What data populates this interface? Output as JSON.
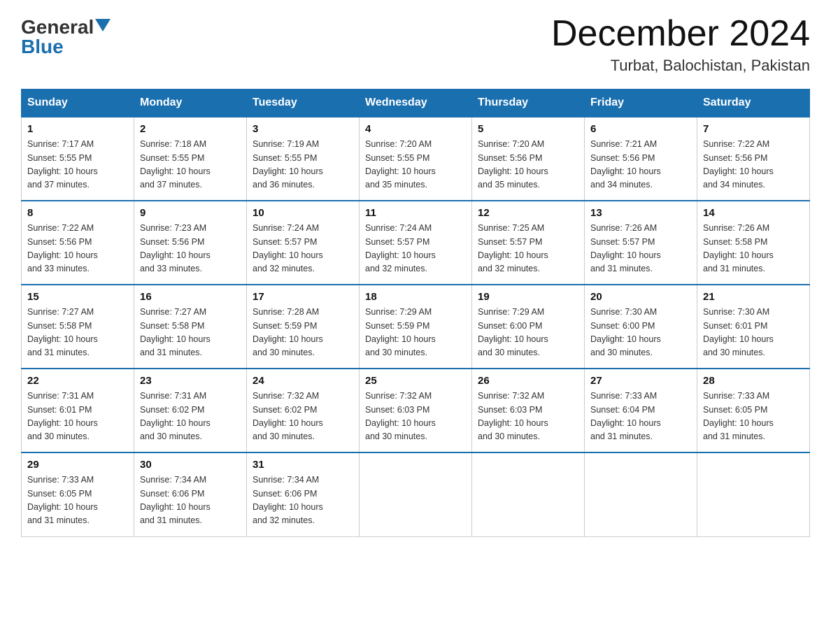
{
  "header": {
    "logo_general": "General",
    "logo_blue": "Blue",
    "month_year": "December 2024",
    "location": "Turbat, Balochistan, Pakistan"
  },
  "columns": [
    "Sunday",
    "Monday",
    "Tuesday",
    "Wednesday",
    "Thursday",
    "Friday",
    "Saturday"
  ],
  "weeks": [
    [
      {
        "day": "1",
        "sunrise": "7:17 AM",
        "sunset": "5:55 PM",
        "daylight": "10 hours and 37 minutes."
      },
      {
        "day": "2",
        "sunrise": "7:18 AM",
        "sunset": "5:55 PM",
        "daylight": "10 hours and 37 minutes."
      },
      {
        "day": "3",
        "sunrise": "7:19 AM",
        "sunset": "5:55 PM",
        "daylight": "10 hours and 36 minutes."
      },
      {
        "day": "4",
        "sunrise": "7:20 AM",
        "sunset": "5:55 PM",
        "daylight": "10 hours and 35 minutes."
      },
      {
        "day": "5",
        "sunrise": "7:20 AM",
        "sunset": "5:56 PM",
        "daylight": "10 hours and 35 minutes."
      },
      {
        "day": "6",
        "sunrise": "7:21 AM",
        "sunset": "5:56 PM",
        "daylight": "10 hours and 34 minutes."
      },
      {
        "day": "7",
        "sunrise": "7:22 AM",
        "sunset": "5:56 PM",
        "daylight": "10 hours and 34 minutes."
      }
    ],
    [
      {
        "day": "8",
        "sunrise": "7:22 AM",
        "sunset": "5:56 PM",
        "daylight": "10 hours and 33 minutes."
      },
      {
        "day": "9",
        "sunrise": "7:23 AM",
        "sunset": "5:56 PM",
        "daylight": "10 hours and 33 minutes."
      },
      {
        "day": "10",
        "sunrise": "7:24 AM",
        "sunset": "5:57 PM",
        "daylight": "10 hours and 32 minutes."
      },
      {
        "day": "11",
        "sunrise": "7:24 AM",
        "sunset": "5:57 PM",
        "daylight": "10 hours and 32 minutes."
      },
      {
        "day": "12",
        "sunrise": "7:25 AM",
        "sunset": "5:57 PM",
        "daylight": "10 hours and 32 minutes."
      },
      {
        "day": "13",
        "sunrise": "7:26 AM",
        "sunset": "5:57 PM",
        "daylight": "10 hours and 31 minutes."
      },
      {
        "day": "14",
        "sunrise": "7:26 AM",
        "sunset": "5:58 PM",
        "daylight": "10 hours and 31 minutes."
      }
    ],
    [
      {
        "day": "15",
        "sunrise": "7:27 AM",
        "sunset": "5:58 PM",
        "daylight": "10 hours and 31 minutes."
      },
      {
        "day": "16",
        "sunrise": "7:27 AM",
        "sunset": "5:58 PM",
        "daylight": "10 hours and 31 minutes."
      },
      {
        "day": "17",
        "sunrise": "7:28 AM",
        "sunset": "5:59 PM",
        "daylight": "10 hours and 30 minutes."
      },
      {
        "day": "18",
        "sunrise": "7:29 AM",
        "sunset": "5:59 PM",
        "daylight": "10 hours and 30 minutes."
      },
      {
        "day": "19",
        "sunrise": "7:29 AM",
        "sunset": "6:00 PM",
        "daylight": "10 hours and 30 minutes."
      },
      {
        "day": "20",
        "sunrise": "7:30 AM",
        "sunset": "6:00 PM",
        "daylight": "10 hours and 30 minutes."
      },
      {
        "day": "21",
        "sunrise": "7:30 AM",
        "sunset": "6:01 PM",
        "daylight": "10 hours and 30 minutes."
      }
    ],
    [
      {
        "day": "22",
        "sunrise": "7:31 AM",
        "sunset": "6:01 PM",
        "daylight": "10 hours and 30 minutes."
      },
      {
        "day": "23",
        "sunrise": "7:31 AM",
        "sunset": "6:02 PM",
        "daylight": "10 hours and 30 minutes."
      },
      {
        "day": "24",
        "sunrise": "7:32 AM",
        "sunset": "6:02 PM",
        "daylight": "10 hours and 30 minutes."
      },
      {
        "day": "25",
        "sunrise": "7:32 AM",
        "sunset": "6:03 PM",
        "daylight": "10 hours and 30 minutes."
      },
      {
        "day": "26",
        "sunrise": "7:32 AM",
        "sunset": "6:03 PM",
        "daylight": "10 hours and 30 minutes."
      },
      {
        "day": "27",
        "sunrise": "7:33 AM",
        "sunset": "6:04 PM",
        "daylight": "10 hours and 31 minutes."
      },
      {
        "day": "28",
        "sunrise": "7:33 AM",
        "sunset": "6:05 PM",
        "daylight": "10 hours and 31 minutes."
      }
    ],
    [
      {
        "day": "29",
        "sunrise": "7:33 AM",
        "sunset": "6:05 PM",
        "daylight": "10 hours and 31 minutes."
      },
      {
        "day": "30",
        "sunrise": "7:34 AM",
        "sunset": "6:06 PM",
        "daylight": "10 hours and 31 minutes."
      },
      {
        "day": "31",
        "sunrise": "7:34 AM",
        "sunset": "6:06 PM",
        "daylight": "10 hours and 32 minutes."
      },
      null,
      null,
      null,
      null
    ]
  ],
  "labels": {
    "sunrise": "Sunrise:",
    "sunset": "Sunset:",
    "daylight": "Daylight:"
  }
}
